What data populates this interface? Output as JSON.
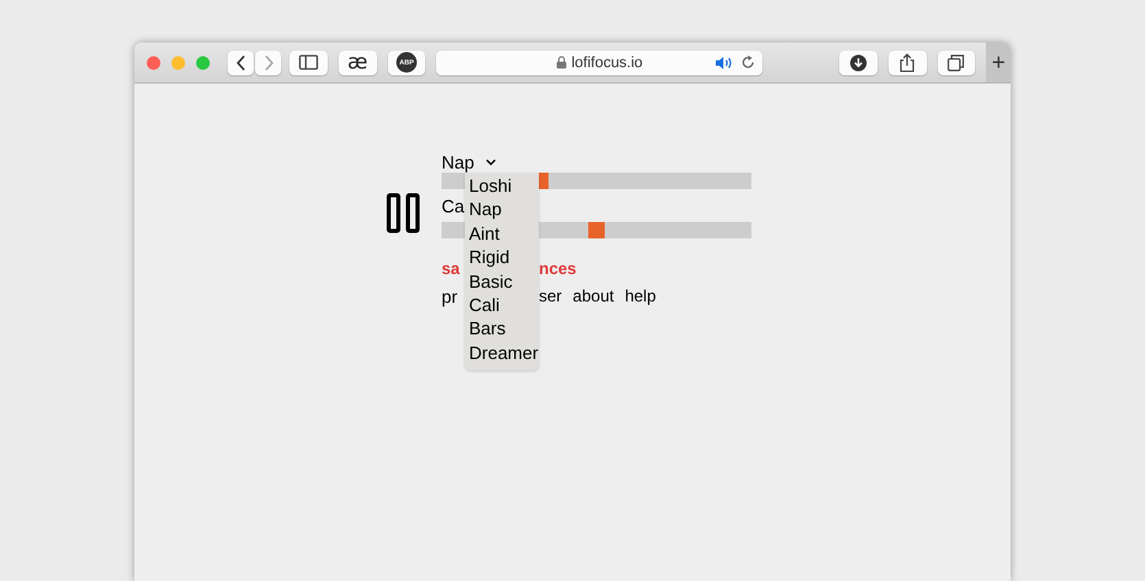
{
  "browser": {
    "ae_button": "æ",
    "adblock_badge": "ABP",
    "url": "lofifocus.io",
    "audio_playing": true,
    "new_tab_button": "+"
  },
  "player": {
    "playing": true
  },
  "preset_select": {
    "value": "Nap",
    "expanded": true,
    "options": [
      "Loshi",
      "Nap",
      "Aint",
      "Rigid",
      "Basic",
      "Cali",
      "Bars",
      "Dreamer"
    ]
  },
  "lines": [
    {
      "kind": "slider",
      "level": 0.32
    },
    {
      "kind": "text",
      "before_menu": [
        "Ca"
      ]
    },
    {
      "kind": "slider",
      "level": 0.5
    },
    {
      "kind": "alert",
      "before_menu": [
        "sa"
      ],
      "after_menu": [
        "nces"
      ]
    },
    {
      "kind": "text",
      "before_menu": [
        "pr"
      ],
      "after_menu": [
        "ser",
        "about",
        "help"
      ]
    }
  ]
}
